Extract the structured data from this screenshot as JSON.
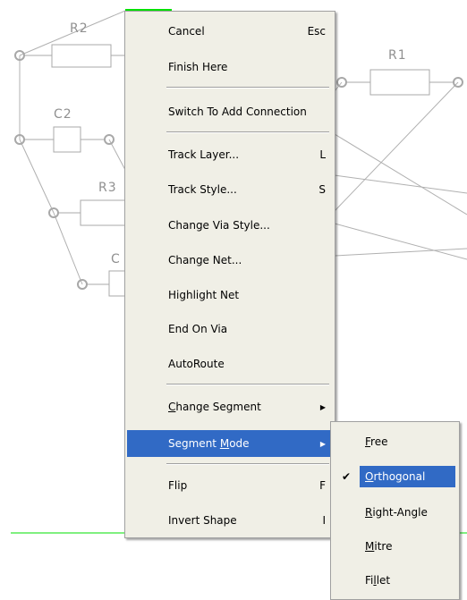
{
  "schematic": {
    "labels": [
      "R2",
      "C2",
      "R3",
      "C",
      "R1"
    ]
  },
  "main_menu": {
    "items": [
      {
        "label": "Cancel",
        "shortcut": "Esc"
      },
      {
        "label": "Finish Here"
      },
      {
        "label": "Switch To Add Connection"
      },
      {
        "label": "Track Layer...",
        "shortcut": "L"
      },
      {
        "label": "Track Style...",
        "shortcut": "S"
      },
      {
        "label": "Change Via Style..."
      },
      {
        "label": "Change Net..."
      },
      {
        "label": "Highlight Net"
      },
      {
        "label": "End On Via"
      },
      {
        "label": "AutoRoute"
      },
      {
        "label": "Change Segment",
        "accel": "C",
        "rest": "hange Segment",
        "submenu": true
      },
      {
        "label": "Segment Mode",
        "pre": "Segment ",
        "accel": "M",
        "rest": "ode",
        "submenu": true,
        "highlighted": true
      },
      {
        "label": "Flip",
        "shortcut": "F"
      },
      {
        "label": "Invert Shape",
        "shortcut": "I"
      }
    ]
  },
  "submenu": {
    "items": [
      {
        "label": "Free",
        "accel": "F",
        "rest": "ree"
      },
      {
        "label": "Orthogonal",
        "accel": "O",
        "rest": "rthogonal",
        "checked": true,
        "highlighted": true
      },
      {
        "label": "Right-Angle",
        "accel": "R",
        "rest": "ight-Angle"
      },
      {
        "label": "Mitre",
        "accel": "M",
        "rest": "itre"
      },
      {
        "label": "Fillet",
        "pre": "Fi",
        "accel": "l",
        "rest": "let"
      }
    ]
  },
  "colors": {
    "selection": "#316ac5",
    "menu_bg": "#f0efe6",
    "wire": "#b0b0b0",
    "track": "#00e000"
  }
}
